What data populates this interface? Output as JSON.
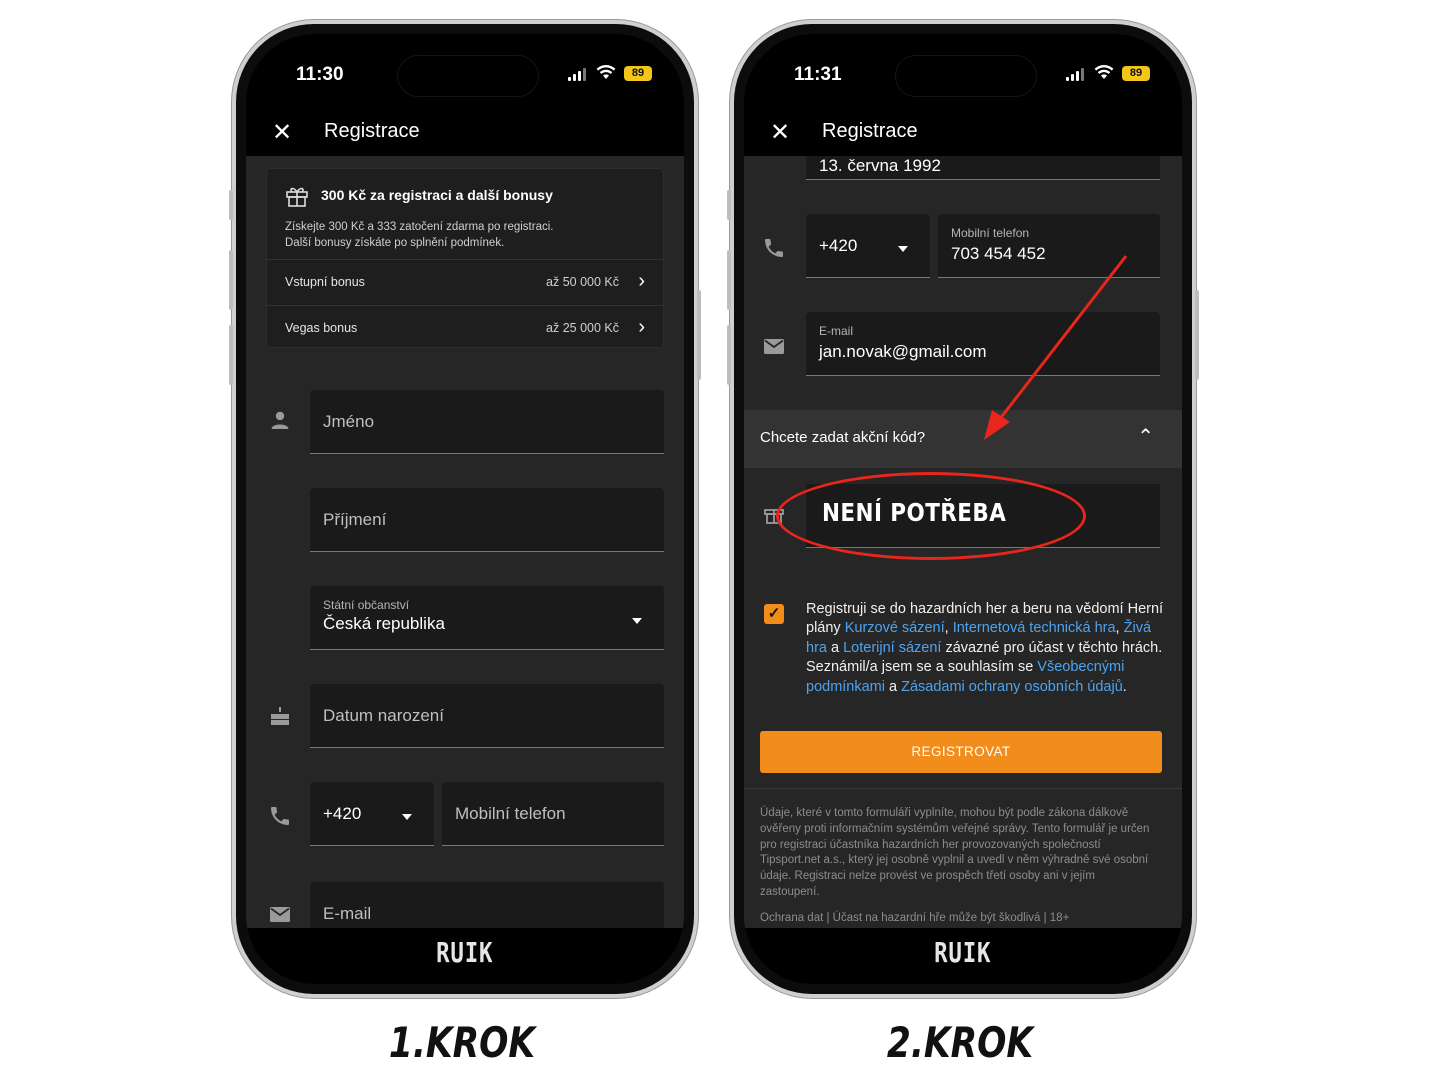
{
  "step1": {
    "label": "1.KROK",
    "status": {
      "time": "11:30",
      "battery": "89"
    },
    "header": {
      "close": "✕",
      "title": "Registrace"
    },
    "bonus": {
      "title": "300 Kč za registraci a další bonusy",
      "desc1": "Získejte 300 Kč a 333 zatočení zdarma po registraci.",
      "desc2": "Další bonusy získáte po splnění podmínek.",
      "rows": [
        {
          "label": "Vstupní bonus",
          "value": "až 50 000 Kč"
        },
        {
          "label": "Vegas bonus",
          "value": "až 25 000 Kč"
        }
      ]
    },
    "form": {
      "first_name": "Jméno",
      "last_name": "Příjmení",
      "citizenship_label": "Státní občanství",
      "citizenship_value": "Česká republika",
      "birth_date": "Datum narození",
      "prefix": "+420",
      "phone": "Mobilní telefon",
      "email": "E-mail"
    },
    "brand": "RUIK"
  },
  "step2": {
    "label": "2.KROK",
    "status": {
      "time": "11:31",
      "battery": "89"
    },
    "header": {
      "close": "✕",
      "title": "Registrace"
    },
    "form": {
      "birth_value": "13. června 1992",
      "prefix": "+420",
      "phone_label": "Mobilní telefon",
      "phone_value": "703 454 452",
      "email_label": "E-mail",
      "email_value": "jan.novak@gmail.com"
    },
    "promo": {
      "question": "Chcete zadat akční kód?",
      "annotation": "NENÍ POTŘEBA"
    },
    "consent": {
      "p1": "Registruji se do hazardních her a beru na vědomí Herní plány ",
      "l1": "Kurzové sázení",
      "s1": ", ",
      "l2": "Internetová technická hra",
      "s2": ", ",
      "l3": "Živá hra",
      "s3": " a ",
      "l4": "Loterijní sázení",
      "p2": " závazné pro účast v těchto hrách. Seznámil/a jsem se a souhlasím se ",
      "l5": "Všeobecnými podmínkami",
      "s4": " a ",
      "l6": "Zásadami ochrany osobních údajů",
      "p3": "."
    },
    "register_button": "REGISTROVAT",
    "legal": "Údaje, které v tomto formuláři vyplníte, mohou být podle zákona dálkově ověřeny proti informačním systémům veřejné správy. Tento formulář je určen pro registraci účastníka hazardních her provozovaných společností Tipsport.net a.s., který jej osobně vyplnil a uvedl v něm výhradně své osobní údaje. Registraci nelze provést ve prospěch třetí osoby ani v jejím zastoupení.",
    "legal_links": "Ochrana dat | Účast na hazardní hře může být škodlivá | 18+",
    "brand": "RUIK"
  },
  "colors": {
    "accent": "#f28c1a",
    "annotation": "#e8261c",
    "link": "#4ea3f0"
  }
}
